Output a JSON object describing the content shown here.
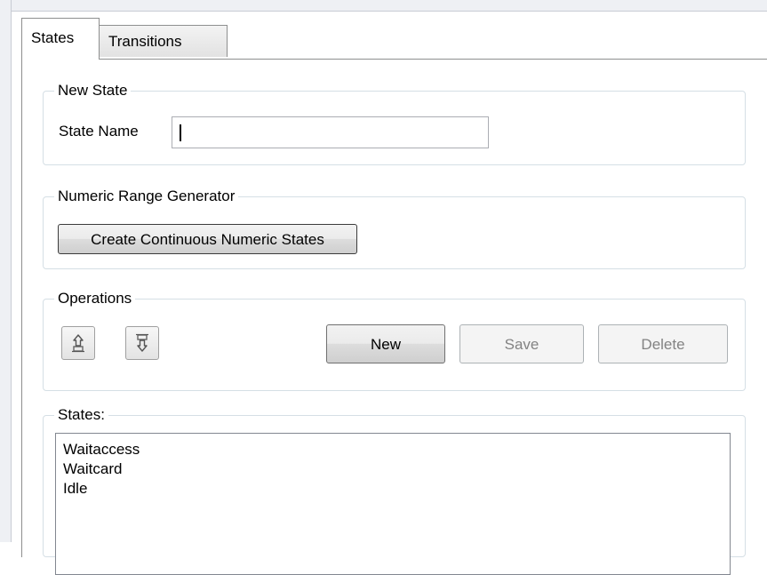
{
  "tabs": [
    {
      "label": "States",
      "active": true
    },
    {
      "label": "Transitions",
      "active": false
    }
  ],
  "new_state": {
    "legend": "New State",
    "name_label": "State Name",
    "name_value": ""
  },
  "numeric_range": {
    "legend": "Numeric Range Generator",
    "button_label": "Create Continuous Numeric States"
  },
  "operations": {
    "legend": "Operations",
    "icons": [
      "move-up-icon",
      "move-down-icon"
    ],
    "new_label": "New",
    "save_label": "Save",
    "delete_label": "Delete"
  },
  "states": {
    "legend": "States:",
    "items": [
      "Waitaccess",
      "Waitcard",
      "Idle"
    ]
  },
  "colors": {
    "group_border": "#d5dfe5",
    "disabled_text": "#838383"
  }
}
